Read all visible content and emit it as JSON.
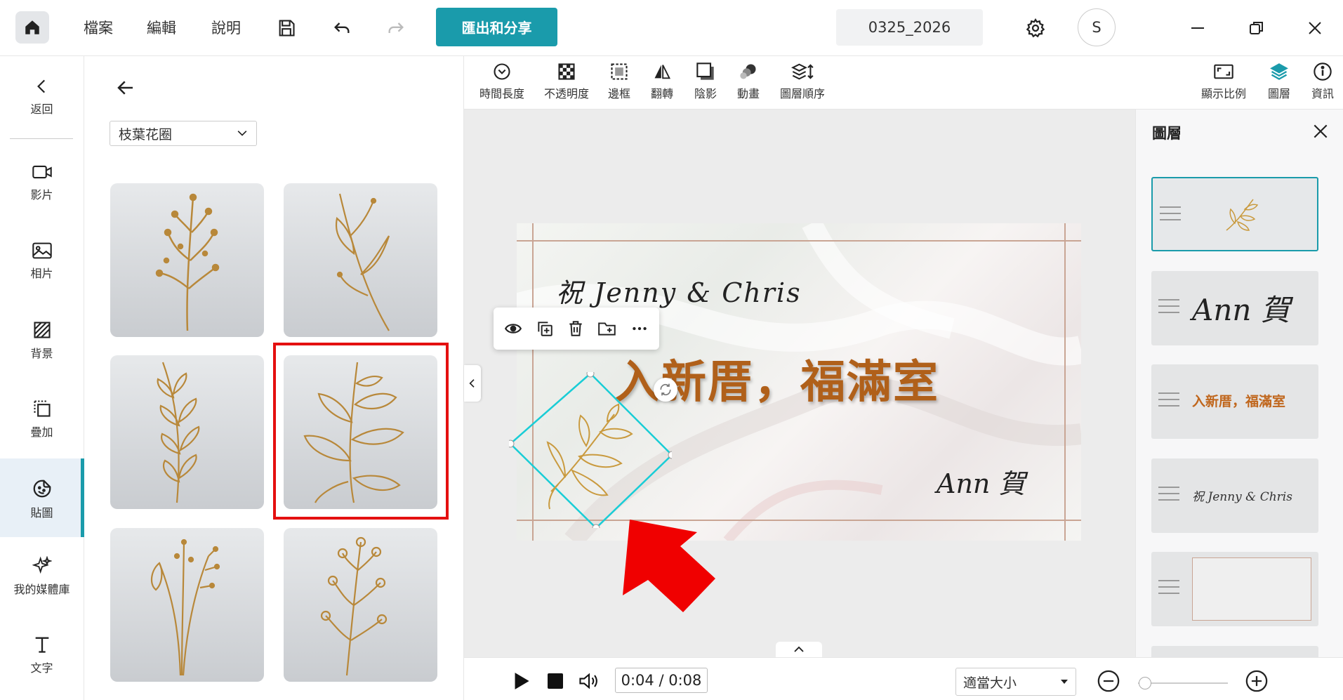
{
  "menu": {
    "file": "檔案",
    "edit": "編輯",
    "help": "說明"
  },
  "header": {
    "export_label": "匯出和分享",
    "project_name": "0325_2026",
    "avatar_letter": "S"
  },
  "leftnav": {
    "items": [
      {
        "label": "返回"
      },
      {
        "label": "影片"
      },
      {
        "label": "相片"
      },
      {
        "label": "背景"
      },
      {
        "label": "疊加"
      },
      {
        "label": "貼圖"
      },
      {
        "label": "我的媒體庫"
      },
      {
        "label": "文字"
      }
    ],
    "active": "貼圖"
  },
  "panel": {
    "category": "枝葉花圈"
  },
  "toolbar": {
    "tools": [
      {
        "label": "時間長度"
      },
      {
        "label": "不透明度"
      },
      {
        "label": "邊框"
      },
      {
        "label": "翻轉"
      },
      {
        "label": "陰影"
      },
      {
        "label": "動畫"
      },
      {
        "label": "圖層順序"
      }
    ],
    "right": [
      {
        "label": "顯示比例"
      },
      {
        "label": "圖層"
      },
      {
        "label": "資訊"
      }
    ]
  },
  "slide": {
    "line1": "祝 Jenny & Chris",
    "line2": "入新厝，福滿室",
    "line3": "Ann 賀"
  },
  "layers_panel": {
    "title": "圖層",
    "items": [
      {
        "text": ""
      },
      {
        "text": "Ann 賀"
      },
      {
        "text": "入新厝，福滿室"
      },
      {
        "text": "祝 Jenny & Chris"
      },
      {
        "text": ""
      }
    ]
  },
  "player": {
    "time": "0:04 / 0:08",
    "zoom": "適當大小"
  },
  "colors": {
    "accent": "#1a9bab",
    "highlight": "#e41010",
    "gold": "#b8883a",
    "title_text": "#b0601a"
  }
}
